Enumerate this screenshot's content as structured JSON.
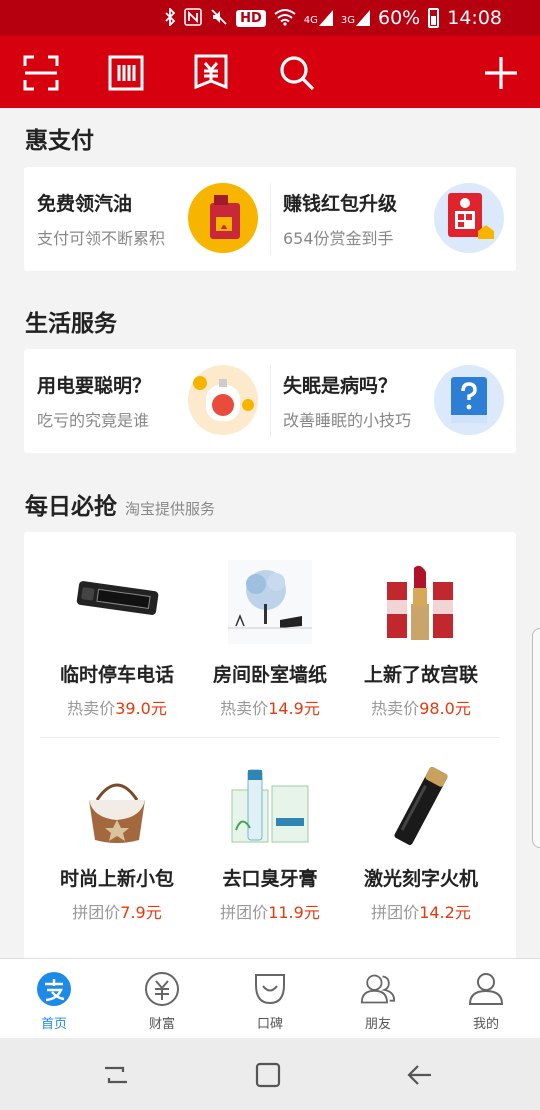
{
  "status_bar": {
    "battery_percent": "60%",
    "time": "14:08",
    "hd_label": "HD",
    "net1": "4G",
    "net2": "3G"
  },
  "header": {
    "icons": [
      "scan-icon",
      "barcode-icon",
      "payment-code-icon",
      "search-icon",
      "add-icon"
    ]
  },
  "section_hui": {
    "title": "惠支付",
    "items": [
      {
        "title": "免费领汽油",
        "subtitle": "支付可领不断累积",
        "icon": "fuel-can-icon"
      },
      {
        "title": "赚钱红包升级",
        "subtitle": "654份赏金到手",
        "icon": "red-envelope-icon"
      }
    ]
  },
  "section_life": {
    "title": "生活服务",
    "items": [
      {
        "title": "用电要聪明？",
        "subtitle": "吃亏的究竟是谁",
        "icon": "electricity-bill-icon"
      },
      {
        "title": "失眠是病吗？",
        "subtitle": "改善睡眠的小技巧",
        "icon": "question-book-icon"
      }
    ]
  },
  "section_daily": {
    "title": "每日必抢",
    "subtitle": "淘宝提供服务",
    "products": [
      {
        "name": "临时停车电话",
        "price_label": "热卖价",
        "price": "39.0元",
        "icon": "parking-card-image"
      },
      {
        "name": "房间卧室墙纸",
        "price_label": "热卖价",
        "price": "14.9元",
        "icon": "wallpaper-image"
      },
      {
        "name": "上新了故宫联",
        "price_label": "热卖价",
        "price": "98.0元",
        "icon": "lipstick-image"
      },
      {
        "name": "时尚上新小包",
        "price_label": "拼团价",
        "price": "7.9元",
        "icon": "handbag-image"
      },
      {
        "name": "去口臭牙膏",
        "price_label": "拼团价",
        "price": "11.9元",
        "icon": "toothpaste-image"
      },
      {
        "name": "激光刻字火机",
        "price_label": "拼团价",
        "price": "14.2元",
        "icon": "lighter-image"
      }
    ]
  },
  "tabbar": {
    "tabs": [
      {
        "label": "首页",
        "icon": "alipay-home-icon",
        "active": true
      },
      {
        "label": "财富",
        "icon": "wealth-yen-icon",
        "active": false
      },
      {
        "label": "口碑",
        "icon": "koubei-icon",
        "active": false
      },
      {
        "label": "朋友",
        "icon": "friends-icon",
        "active": false
      },
      {
        "label": "我的",
        "icon": "profile-icon",
        "active": false
      }
    ]
  },
  "colors": {
    "brand_red": "#d6000f",
    "status_red": "#b60010",
    "price_orange": "#e8380d",
    "active_blue": "#1e8ae8"
  }
}
